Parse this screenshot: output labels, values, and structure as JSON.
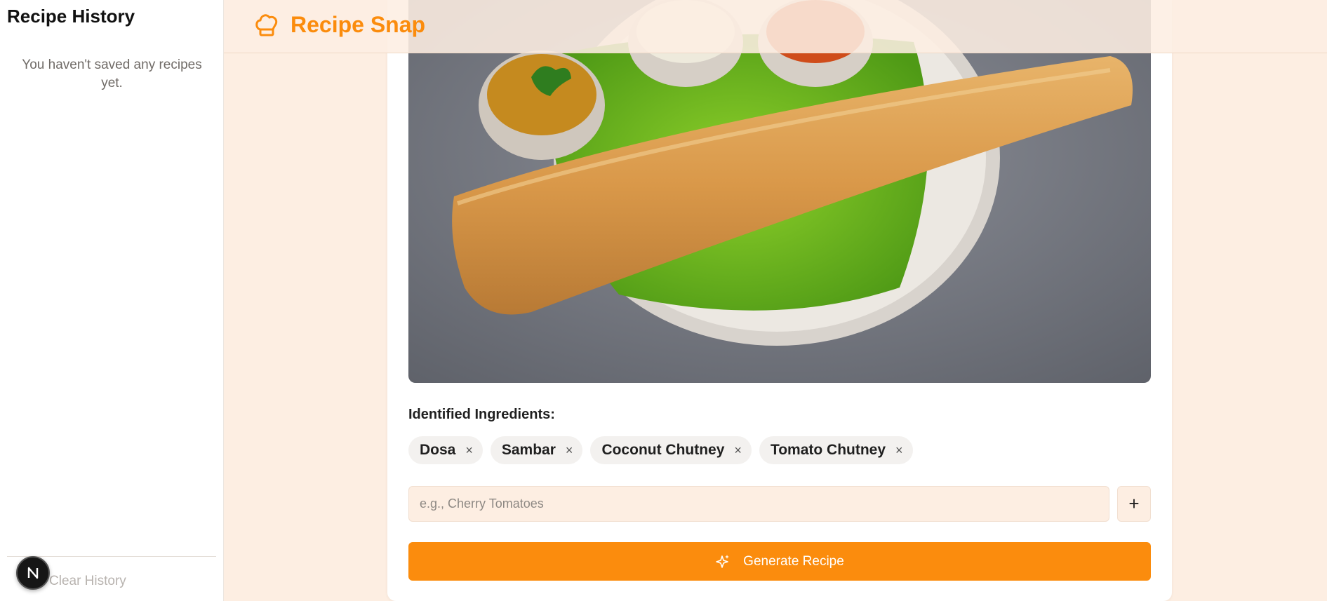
{
  "sidebar": {
    "title": "Recipe History",
    "empty_message": "You haven't saved any recipes yet.",
    "clear_label": "Clear History"
  },
  "devtools_badge": {
    "letter": "N"
  },
  "header": {
    "app_name": "Recipe Snap",
    "icon": "chef-hat-icon"
  },
  "main": {
    "photo_description_icon": "food-photo",
    "ingredients_title": "Identified Ingredients:",
    "ingredients": [
      {
        "label": "Dosa"
      },
      {
        "label": "Sambar"
      },
      {
        "label": "Coconut Chutney"
      },
      {
        "label": "Tomato Chutney"
      }
    ],
    "remove_glyph": "×",
    "input": {
      "placeholder": "e.g., Cherry Tomatoes",
      "value": ""
    },
    "add_glyph": "+",
    "generate_label": "Generate Recipe"
  },
  "colors": {
    "accent": "#fb8c0d",
    "background": "#fdeee2",
    "card": "#ffffff"
  }
}
